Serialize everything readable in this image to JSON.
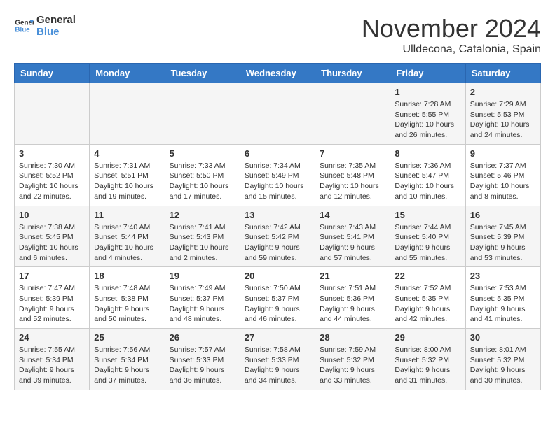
{
  "logo": {
    "line1": "General",
    "line2": "Blue"
  },
  "title": "November 2024",
  "location": "Ulldecona, Catalonia, Spain",
  "days_of_week": [
    "Sunday",
    "Monday",
    "Tuesday",
    "Wednesday",
    "Thursday",
    "Friday",
    "Saturday"
  ],
  "weeks": [
    [
      {
        "day": "",
        "info": ""
      },
      {
        "day": "",
        "info": ""
      },
      {
        "day": "",
        "info": ""
      },
      {
        "day": "",
        "info": ""
      },
      {
        "day": "",
        "info": ""
      },
      {
        "day": "1",
        "info": "Sunrise: 7:28 AM\nSunset: 5:55 PM\nDaylight: 10 hours and 26 minutes."
      },
      {
        "day": "2",
        "info": "Sunrise: 7:29 AM\nSunset: 5:53 PM\nDaylight: 10 hours and 24 minutes."
      }
    ],
    [
      {
        "day": "3",
        "info": "Sunrise: 7:30 AM\nSunset: 5:52 PM\nDaylight: 10 hours and 22 minutes."
      },
      {
        "day": "4",
        "info": "Sunrise: 7:31 AM\nSunset: 5:51 PM\nDaylight: 10 hours and 19 minutes."
      },
      {
        "day": "5",
        "info": "Sunrise: 7:33 AM\nSunset: 5:50 PM\nDaylight: 10 hours and 17 minutes."
      },
      {
        "day": "6",
        "info": "Sunrise: 7:34 AM\nSunset: 5:49 PM\nDaylight: 10 hours and 15 minutes."
      },
      {
        "day": "7",
        "info": "Sunrise: 7:35 AM\nSunset: 5:48 PM\nDaylight: 10 hours and 12 minutes."
      },
      {
        "day": "8",
        "info": "Sunrise: 7:36 AM\nSunset: 5:47 PM\nDaylight: 10 hours and 10 minutes."
      },
      {
        "day": "9",
        "info": "Sunrise: 7:37 AM\nSunset: 5:46 PM\nDaylight: 10 hours and 8 minutes."
      }
    ],
    [
      {
        "day": "10",
        "info": "Sunrise: 7:38 AM\nSunset: 5:45 PM\nDaylight: 10 hours and 6 minutes."
      },
      {
        "day": "11",
        "info": "Sunrise: 7:40 AM\nSunset: 5:44 PM\nDaylight: 10 hours and 4 minutes."
      },
      {
        "day": "12",
        "info": "Sunrise: 7:41 AM\nSunset: 5:43 PM\nDaylight: 10 hours and 2 minutes."
      },
      {
        "day": "13",
        "info": "Sunrise: 7:42 AM\nSunset: 5:42 PM\nDaylight: 9 hours and 59 minutes."
      },
      {
        "day": "14",
        "info": "Sunrise: 7:43 AM\nSunset: 5:41 PM\nDaylight: 9 hours and 57 minutes."
      },
      {
        "day": "15",
        "info": "Sunrise: 7:44 AM\nSunset: 5:40 PM\nDaylight: 9 hours and 55 minutes."
      },
      {
        "day": "16",
        "info": "Sunrise: 7:45 AM\nSunset: 5:39 PM\nDaylight: 9 hours and 53 minutes."
      }
    ],
    [
      {
        "day": "17",
        "info": "Sunrise: 7:47 AM\nSunset: 5:39 PM\nDaylight: 9 hours and 52 minutes."
      },
      {
        "day": "18",
        "info": "Sunrise: 7:48 AM\nSunset: 5:38 PM\nDaylight: 9 hours and 50 minutes."
      },
      {
        "day": "19",
        "info": "Sunrise: 7:49 AM\nSunset: 5:37 PM\nDaylight: 9 hours and 48 minutes."
      },
      {
        "day": "20",
        "info": "Sunrise: 7:50 AM\nSunset: 5:37 PM\nDaylight: 9 hours and 46 minutes."
      },
      {
        "day": "21",
        "info": "Sunrise: 7:51 AM\nSunset: 5:36 PM\nDaylight: 9 hours and 44 minutes."
      },
      {
        "day": "22",
        "info": "Sunrise: 7:52 AM\nSunset: 5:35 PM\nDaylight: 9 hours and 42 minutes."
      },
      {
        "day": "23",
        "info": "Sunrise: 7:53 AM\nSunset: 5:35 PM\nDaylight: 9 hours and 41 minutes."
      }
    ],
    [
      {
        "day": "24",
        "info": "Sunrise: 7:55 AM\nSunset: 5:34 PM\nDaylight: 9 hours and 39 minutes."
      },
      {
        "day": "25",
        "info": "Sunrise: 7:56 AM\nSunset: 5:34 PM\nDaylight: 9 hours and 37 minutes."
      },
      {
        "day": "26",
        "info": "Sunrise: 7:57 AM\nSunset: 5:33 PM\nDaylight: 9 hours and 36 minutes."
      },
      {
        "day": "27",
        "info": "Sunrise: 7:58 AM\nSunset: 5:33 PM\nDaylight: 9 hours and 34 minutes."
      },
      {
        "day": "28",
        "info": "Sunrise: 7:59 AM\nSunset: 5:32 PM\nDaylight: 9 hours and 33 minutes."
      },
      {
        "day": "29",
        "info": "Sunrise: 8:00 AM\nSunset: 5:32 PM\nDaylight: 9 hours and 31 minutes."
      },
      {
        "day": "30",
        "info": "Sunrise: 8:01 AM\nSunset: 5:32 PM\nDaylight: 9 hours and 30 minutes."
      }
    ]
  ]
}
